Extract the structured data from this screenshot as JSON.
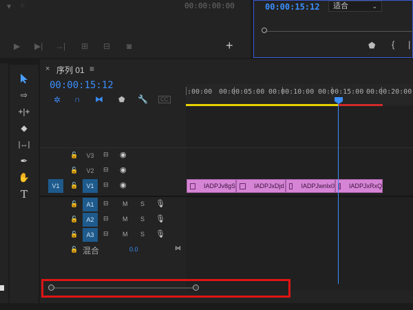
{
  "source_monitor": {
    "timecode": "00:00:00:00",
    "transport_icons": [
      "play-icon",
      "step-forward-icon",
      "insert-icon",
      "overwrite-icon",
      "export-frame-icon",
      "camera-icon"
    ],
    "add_button_label": "+"
  },
  "program_monitor": {
    "timecode": "00:00:15:12",
    "fit_label": "适合",
    "accent_color": "#3b8fff"
  },
  "tools": [
    "selection-tool",
    "track-select-tool",
    "ripple-edit-tool",
    "razor-tool",
    "slip-tool",
    "pen-tool",
    "hand-tool",
    "type-tool"
  ],
  "timeline": {
    "sequence_name": "序列 01",
    "close_label": "×",
    "menu_label": "≡",
    "timecode": "00:00:15:12",
    "ruler_labels": [
      ":00:00",
      "00:00:05:00",
      "00:00:10:00",
      "00:00:15:00",
      "00:00:20:00"
    ],
    "video_tracks": [
      {
        "name": "V3",
        "source": ""
      },
      {
        "name": "V2",
        "source": ""
      },
      {
        "name": "V1",
        "source": "V1"
      }
    ],
    "audio_tracks": [
      {
        "name": "A1",
        "m": "M",
        "s": "S"
      },
      {
        "name": "A2",
        "m": "M",
        "s": "S"
      },
      {
        "name": "A3",
        "m": "M",
        "s": "S"
      }
    ],
    "mix": {
      "label": "混合",
      "value": "0.0"
    },
    "clips": [
      "IADPJv8gS",
      "IADPJxDjd",
      "IADPJwnlx0",
      "IADPJxRxQ"
    ],
    "colors": {
      "playhead": "#3b8fff",
      "clip": "#d685d6",
      "work_area": "#e8d200",
      "render_bar": "#d22a2a",
      "highlight": "#e01414"
    }
  }
}
